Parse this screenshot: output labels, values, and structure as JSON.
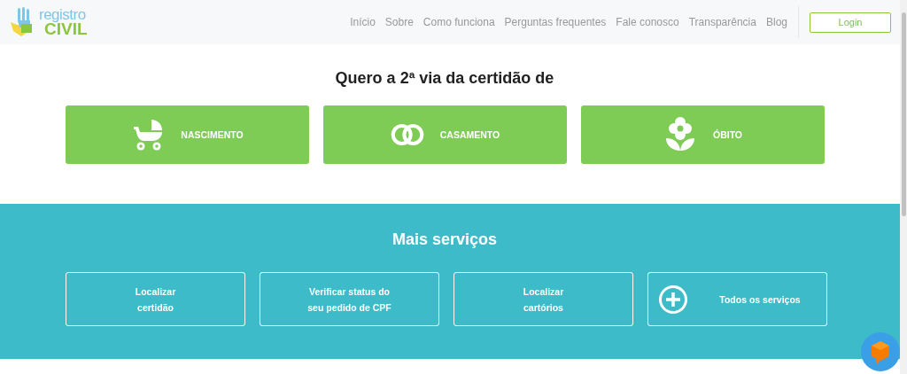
{
  "header": {
    "logo": {
      "top": "registro",
      "bottom": "CIVIL"
    },
    "nav": [
      "Início",
      "Sobre",
      "Como funciona",
      "Perguntas frequentes",
      "Fale conosco",
      "Transparência",
      "Blog"
    ],
    "login": "Login"
  },
  "certificates": {
    "title": "Quero a 2ª via da certidão de",
    "options": [
      {
        "kind": "stroller",
        "label": "NASCIMENTO"
      },
      {
        "kind": "rings",
        "label": "CASAMENTO"
      },
      {
        "kind": "flower",
        "label": "ÓBITO"
      }
    ]
  },
  "services": {
    "title": "Mais serviços",
    "items": [
      {
        "kind": "text",
        "lines": [
          "Localizar",
          "certidão"
        ]
      },
      {
        "kind": "text",
        "lines": [
          "Verificar status do",
          "seu pedido de CPF"
        ]
      },
      {
        "kind": "text",
        "lines": [
          "Localizar",
          "cartórios"
        ]
      },
      {
        "kind": "plus",
        "lines": [
          "Todos os serviços"
        ]
      }
    ]
  }
}
